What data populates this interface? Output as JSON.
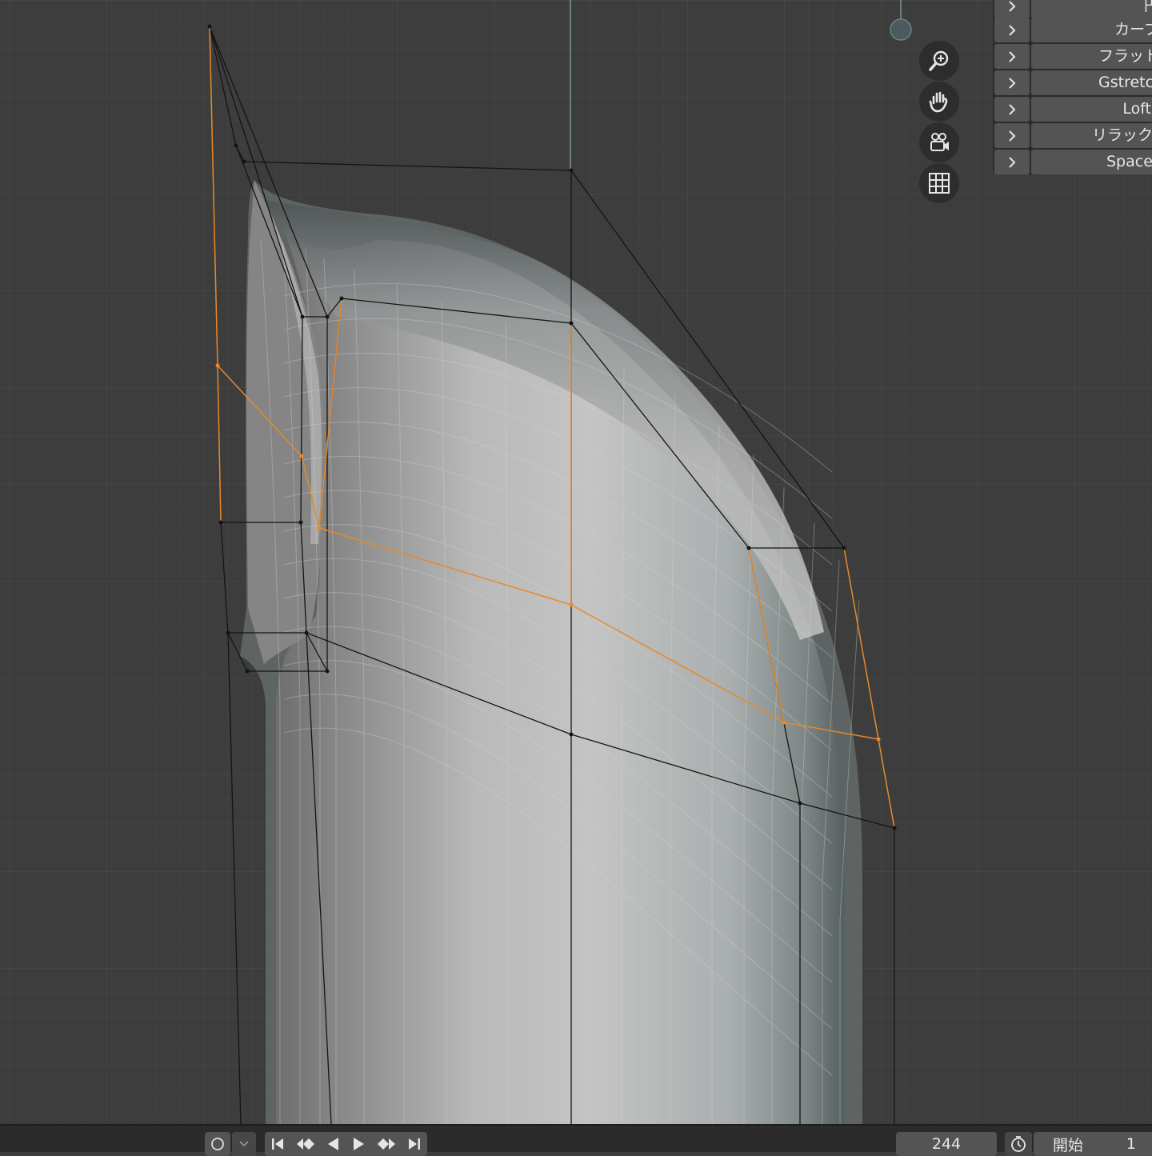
{
  "viewport": {
    "name": "3D Viewport",
    "object": "subdivision surface mesh with control cage"
  },
  "navigation_gizmo": {
    "buttons": [
      {
        "icon": "zoom-icon"
      },
      {
        "icon": "hand-pan-icon"
      },
      {
        "icon": "camera-view-icon"
      },
      {
        "icon": "orthographic-grid-icon"
      }
    ]
  },
  "side_panel": {
    "items": [
      {
        "label": "円"
      },
      {
        "label": "カーブ"
      },
      {
        "label": "フラット"
      },
      {
        "label": "Gstretch"
      },
      {
        "label": "Loft"
      },
      {
        "label": "リラックス"
      },
      {
        "label": "Space"
      }
    ]
  },
  "timeline": {
    "current_frame": "244",
    "start_label": "開始",
    "start_value": "1"
  },
  "colors": {
    "viewport_bg": "#3d3d3d",
    "selected_edge": "#e8892a",
    "cage_edge": "#141414",
    "panel_bg": "#2b2b2b",
    "button_bg": "#545454"
  }
}
